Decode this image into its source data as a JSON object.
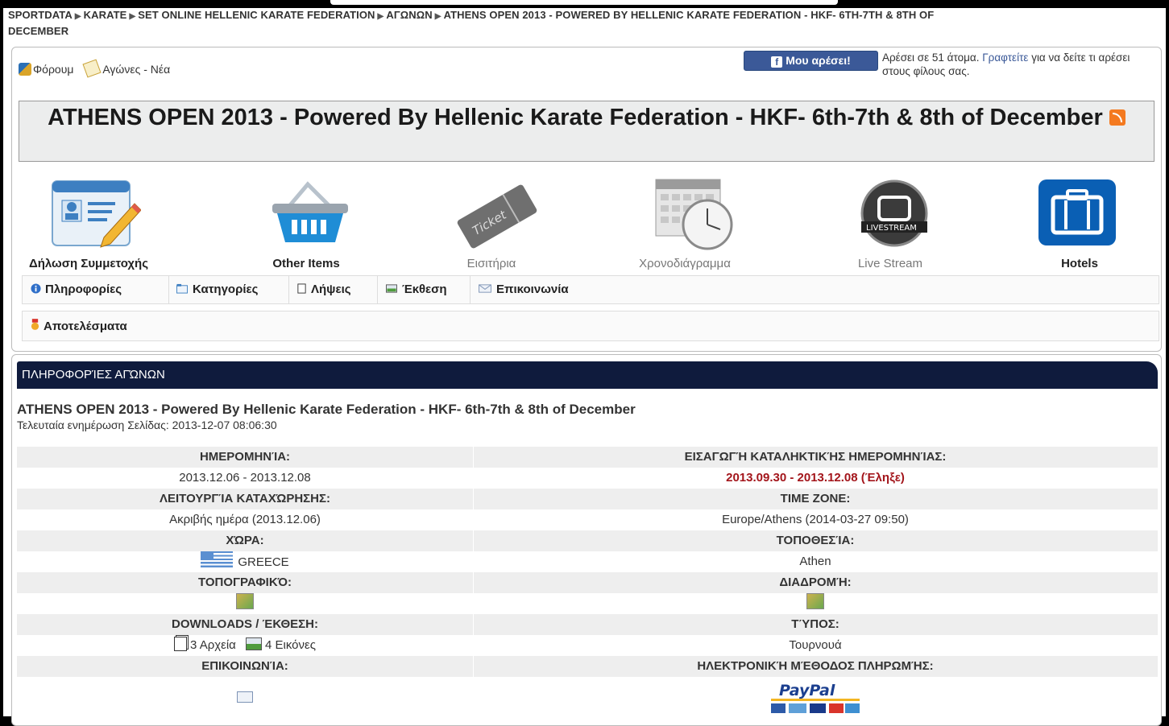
{
  "breadcrumb": {
    "items": [
      "SPORTDATA",
      "KARATE",
      "SET ONLINE HELLENIC KARATE FEDERATION",
      "ΑΓΩΝΩΝ",
      "ATHENS OPEN 2013 - POWERED BY HELLENIC KARATE FEDERATION - HKF- 6TH-7TH & 8TH OF",
      "DECEMBER"
    ]
  },
  "toplinks": {
    "forum": "Φόρουμ",
    "news": "Αγώνες - Νέα"
  },
  "facebook": {
    "button": "Μου αρέσει!",
    "text_prefix": "Αρέσει σε 51 άτομα.",
    "link": "Γραφτείτε",
    "text_suffix": "για να δείτε τι αρέσει στους φίλους σας."
  },
  "event_title": "ATHENS OPEN 2013 - Powered By Hellenic Karate Federation - HKF- 6th-7th & 8th of December",
  "icons": [
    {
      "label": "Δήλωση Συμμετοχής",
      "icon": "registration-form-icon"
    },
    {
      "label": "Other Items",
      "icon": "shopping-basket-icon"
    },
    {
      "label": "Εισιτήρια",
      "icon": "ticket-icon"
    },
    {
      "label": "Χρονοδιάγραμμα",
      "icon": "schedule-clock-icon"
    },
    {
      "label": "Live Stream",
      "icon": "livestream-tv-icon"
    },
    {
      "label": "Hotels",
      "icon": "suitcase-icon"
    }
  ],
  "tabs": [
    {
      "label": "Πληροφορίες",
      "icon": "info-icon"
    },
    {
      "label": "Κατηγορίες",
      "icon": "folder-icon"
    },
    {
      "label": "Λήψεις",
      "icon": "document-icon"
    },
    {
      "label": "Έκθεση",
      "icon": "image-icon"
    },
    {
      "label": "Επικοινωνία",
      "icon": "mail-icon"
    }
  ],
  "results": {
    "label": "Αποτελέσματα",
    "icon": "medal-icon"
  },
  "info": {
    "header": "ΠΛΗΡΟΦΟΡΊΕΣ ΑΓΏΝΩΝ",
    "title": "ATHENS OPEN 2013 - Powered By Hellenic Karate Federation - HKF- 6th-7th & 8th of December",
    "updated": "Τελευταία ενημέρωση Σελίδας: 2013-12-07 08:06:30",
    "date_label": "ΗΜΕΡΟΜΗΝΊΑ:",
    "date_value": "2013.12.06 - 2013.12.08",
    "deadline_label": "ΕΙΣΑΓΩΓΉ ΚΑΤΑΛΗΚΤΙΚΉΣ ΗΜΕΡΟΜΗΝΊΑΣ:",
    "deadline_value": "2013.09.30 - 2013.12.08 (Έληξε)",
    "mode_label": "ΛΕΙΤΟΥΡΓΊΑ ΚΑΤΑΧΏΡΗΣΗΣ:",
    "mode_value": "Ακριβής ημέρα (2013.12.06)",
    "tz_label": "TIME ZONE:",
    "tz_value": "Europe/Athens (2014-03-27 09:50)",
    "country_label": "ΧΏΡΑ:",
    "country_value": "GREECE",
    "place_label": "ΤΟΠΟΘΕΣΊΑ:",
    "place_value": "Athen",
    "topo_label": "ΤΟΠΟΓΡΑΦΙΚΌ:",
    "route_label": "ΔΙΑΔΡΟΜΉ:",
    "downloads_label": "DOWNLOADS / ΈΚΘΕΣΗ:",
    "files_value": "3 Αρχεία",
    "images_value": "4 Εικόνες",
    "type_label": "ΤΎΠΟΣ:",
    "type_value": "Τουρνουά",
    "contact_label": "ΕΠΙΚΟΙΝΩΝΊΑ:",
    "payment_label": "ΗΛΕΚΤΡΟΝΙΚΉ ΜΈΘΟΔΟΣ ΠΛΗΡΩΜΉΣ:",
    "paypal": "PayPal"
  },
  "colors": {
    "header_bar": "#0f1b3d",
    "deadline_red": "#a3151b",
    "facebook": "#3b5998"
  }
}
